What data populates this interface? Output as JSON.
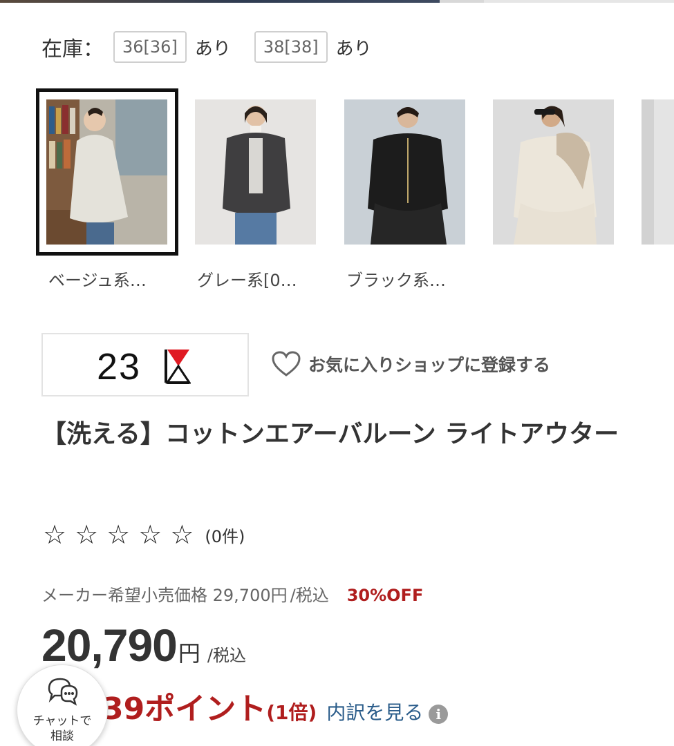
{
  "stock": {
    "label": "在庫：",
    "sizes": [
      {
        "size": "36[36]",
        "availability": "あり"
      },
      {
        "size": "38[38]",
        "availability": "あり"
      }
    ]
  },
  "colors": [
    {
      "label": "ベージュ系…",
      "selected": true
    },
    {
      "label": "グレー系[0…",
      "selected": false
    },
    {
      "label": "ブラック系…",
      "selected": false
    }
  ],
  "shop": {
    "logo_text": "23",
    "favorite_label": "お気に入りショップに登録する"
  },
  "product": {
    "title": "【洗える】コットンエアーバルーン ライトアウター",
    "review_count": "(0件)",
    "stars": 5,
    "rating": 0,
    "msrp": "メーカー希望小売価格 29,700円",
    "msrp_tax": "/税込",
    "discount": "30%OFF",
    "price": "20,790",
    "currency": "円",
    "price_tax": "/税込"
  },
  "points": {
    "value": "39ポイント",
    "multiplier": "(1倍)",
    "breakdown_link": "内訳を見る",
    "info_icon": "info-circle-icon"
  },
  "chat": {
    "label_line1": "チャットで",
    "label_line2": "相談",
    "icon": "chat-bubbles-icon"
  },
  "colors_theme": {
    "sale_red": "#b01e1e",
    "link_blue": "#2a5c8a",
    "text": "#333333"
  }
}
